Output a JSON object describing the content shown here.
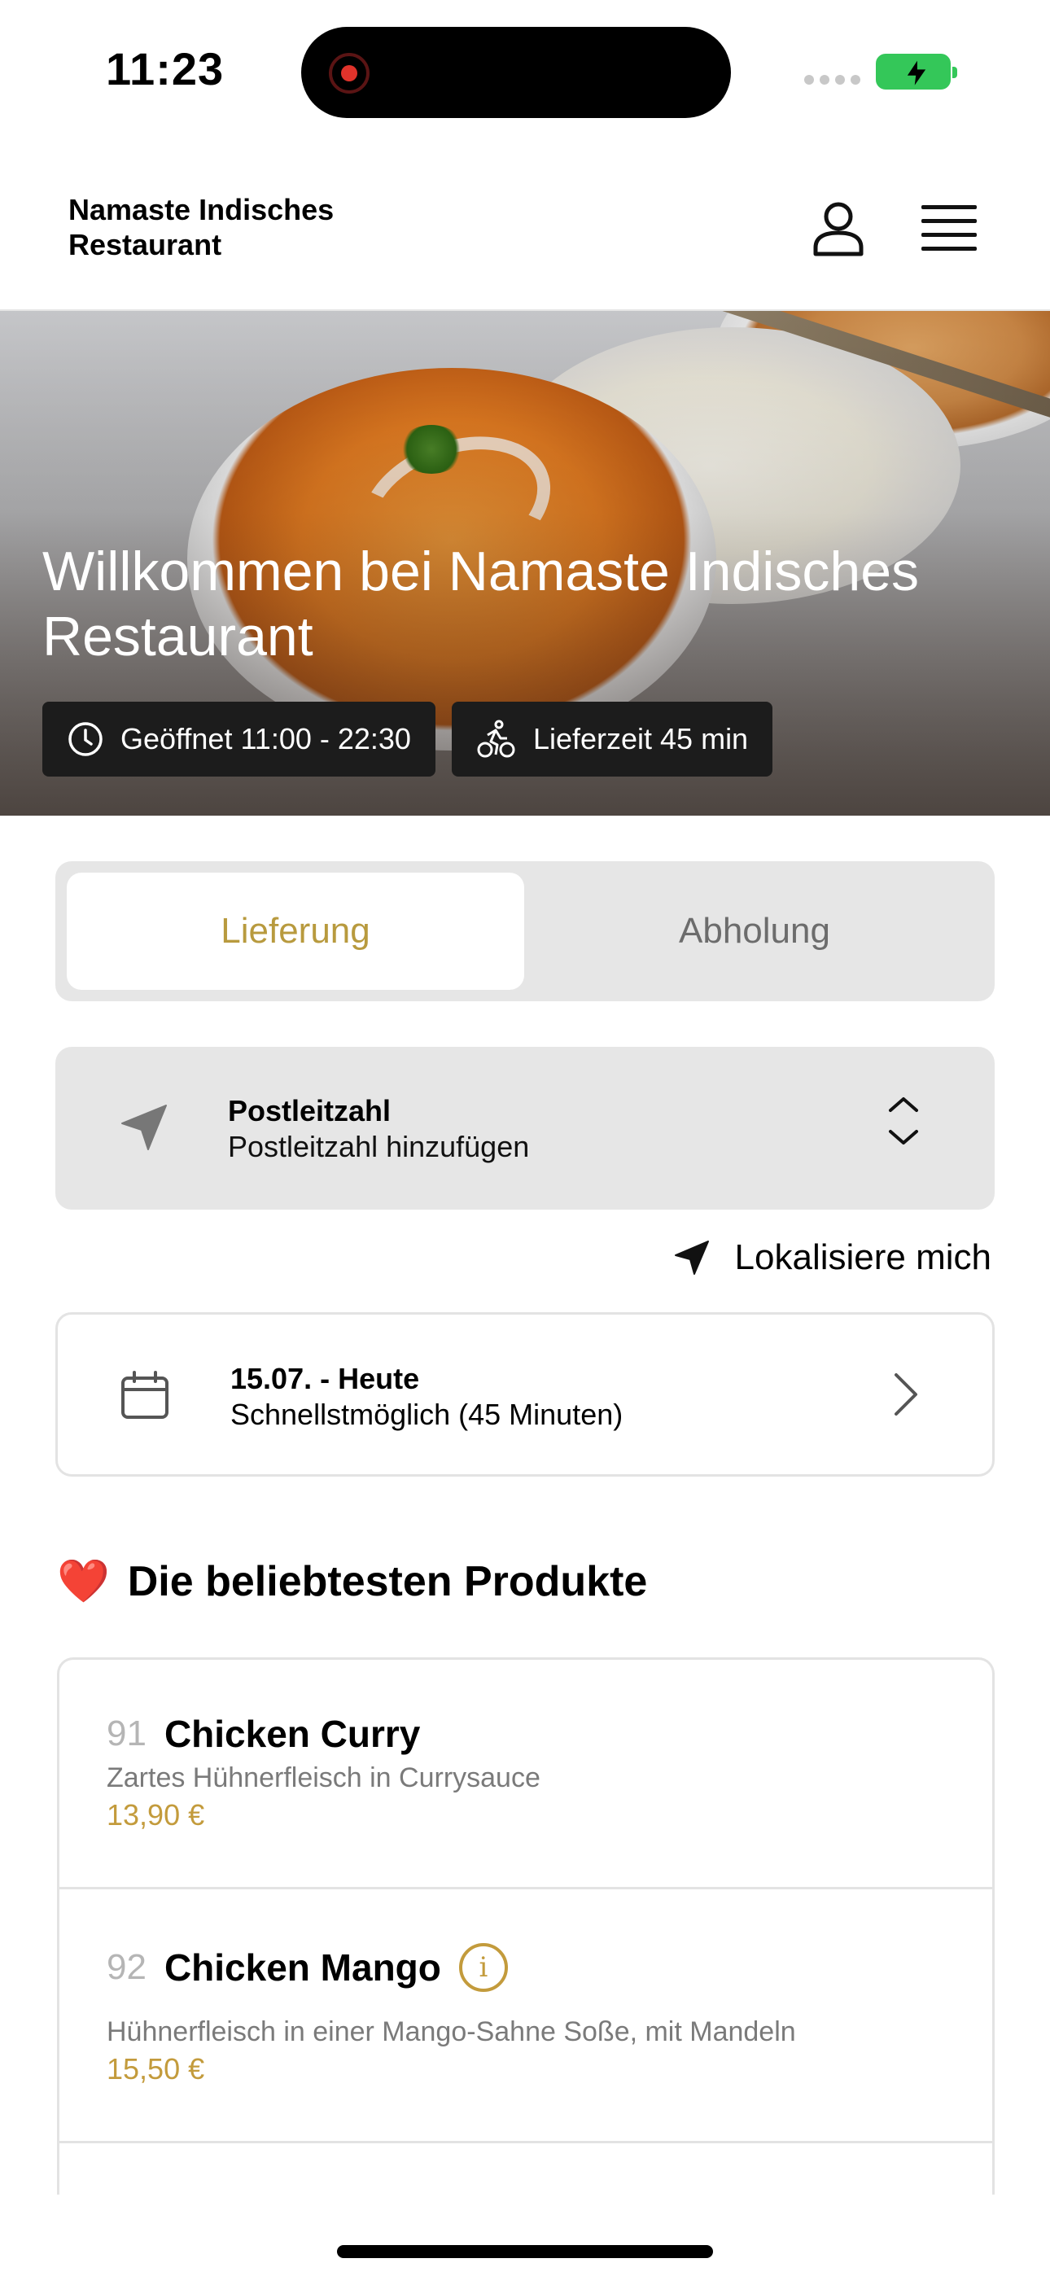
{
  "status_bar": {
    "time": "11:23",
    "battery_color": "#34c759"
  },
  "header": {
    "brand": "Namaste Indisches Restaurant",
    "user_icon": "user-icon",
    "menu_icon": "hamburger-menu-icon"
  },
  "hero": {
    "title": "Willkommen bei Namaste Indisches Restaurant",
    "open_hours": "Geöffnet 11:00 - 22:30",
    "delivery_time": "Lieferzeit 45 min"
  },
  "order_mode": {
    "options": [
      "Lieferung",
      "Abholung"
    ],
    "selected": "Lieferung",
    "accent_color": "#b89a3e"
  },
  "postcode": {
    "title": "Postleitzahl",
    "placeholder": "Postleitzahl hinzufügen"
  },
  "locate_label": "Lokalisiere mich",
  "schedule": {
    "date": "15.07. - Heute",
    "time": "Schnellstmöglich (45 Minuten)"
  },
  "popular": {
    "heading": "Die beliebtesten Produkte",
    "emoji": "❤️",
    "products": [
      {
        "number": "91",
        "name": "Chicken Curry",
        "description": "Zartes Hühnerfleisch in Currysauce",
        "price": "13,90 €"
      },
      {
        "number": "92",
        "name": "Chicken Mango",
        "description": "Hühnerfleisch in einer Mango-Sahne Soße, mit Mandeln",
        "price": "15,50 €"
      }
    ]
  }
}
